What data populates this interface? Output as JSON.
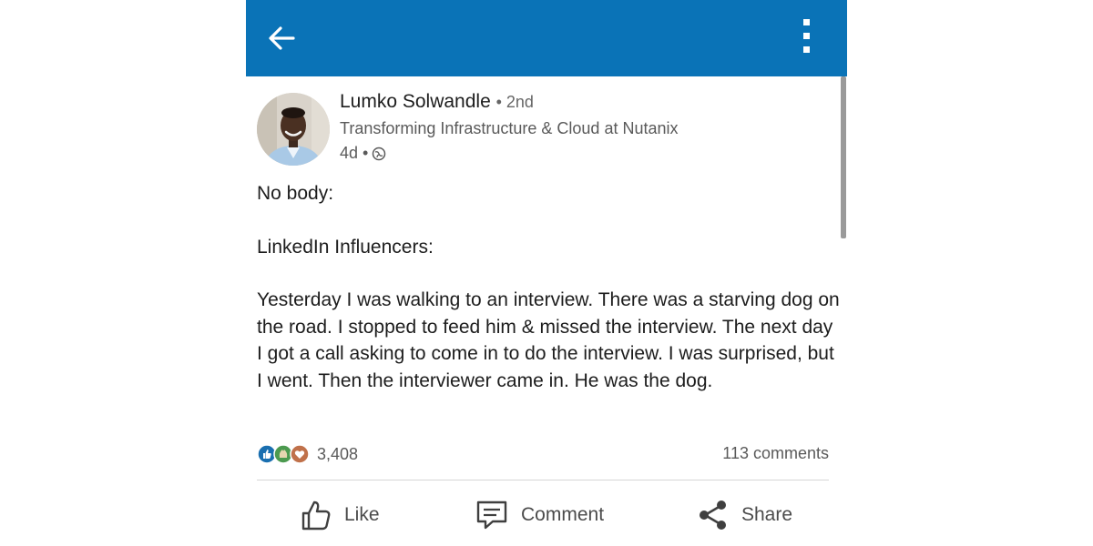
{
  "post": {
    "author": {
      "name": "Lumko Solwandle",
      "degree": "• 2nd",
      "headline": "Transforming Infrastructure & Cloud at Nutanix",
      "time": "4d •"
    },
    "body": {
      "line1": "No body:",
      "line2": "LinkedIn Influencers:",
      "line3": "Yesterday I was walking to an interview. There was a starving dog on the road. I stopped to feed him & missed the interview. The next day I got a call asking to come in to do the interview. I was surprised, but I went. Then the interviewer came in. He was the dog."
    },
    "social": {
      "reaction_count": "3,408",
      "comments": "113 comments"
    },
    "actions": {
      "like": "Like",
      "comment": "Comment",
      "share": "Share"
    }
  },
  "colors": {
    "header": "#0a73b7",
    "text": "#1d1d1d",
    "muted": "#5a5a5a"
  },
  "icons": [
    "back-arrow-icon",
    "more-vertical-icon",
    "globe-icon",
    "like-reaction-icon",
    "celebrate-reaction-icon",
    "love-reaction-icon",
    "thumbs-up-icon",
    "comment-icon",
    "share-icon"
  ]
}
